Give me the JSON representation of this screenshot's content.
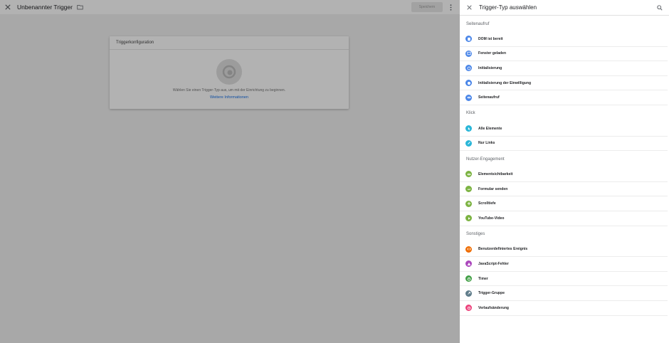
{
  "background": {
    "trigger_title": "Unbenannter Trigger",
    "save_label": "Speichern",
    "card_title": "Triggerkonfiguration",
    "hint": "Wählen Sie einen Trigger-Typ aus, um mit der Einrichtung zu beginnen.",
    "more_info": "Weitere Informationen"
  },
  "panel": {
    "title": "Trigger-Typ auswählen",
    "sections": [
      {
        "title": "Seitenaufruf",
        "items": [
          {
            "label": "DOM ist bereit",
            "icon": "document-icon",
            "color": "#4a86e8"
          },
          {
            "label": "Fenster geladen",
            "icon": "window-icon",
            "color": "#4a86e8"
          },
          {
            "label": "Initialisierung",
            "icon": "power-icon",
            "color": "#4a86e8"
          },
          {
            "label": "Initialisierung der Einwilligung",
            "icon": "consent-icon",
            "color": "#4a86e8"
          },
          {
            "label": "Seitenaufruf",
            "icon": "eye-icon",
            "color": "#4a86e8"
          }
        ]
      },
      {
        "title": "Klick",
        "items": [
          {
            "label": "Alle Elemente",
            "icon": "cursor-icon",
            "color": "#29b6d8"
          },
          {
            "label": "Nur Links",
            "icon": "link-icon",
            "color": "#29b6d8"
          }
        ]
      },
      {
        "title": "Nutzer-Engagement",
        "items": [
          {
            "label": "Elementsichtbarkeit",
            "icon": "visibility-icon",
            "color": "#7cb342"
          },
          {
            "label": "Formular senden",
            "icon": "form-icon",
            "color": "#7cb342"
          },
          {
            "label": "Scrolltiefe",
            "icon": "scroll-icon",
            "color": "#7cb342"
          },
          {
            "label": "YouTube-Video",
            "icon": "play-icon",
            "color": "#7cb342"
          }
        ]
      },
      {
        "title": "Sonstiges",
        "items": [
          {
            "label": "Benutzerdefiniertes Ereignis",
            "icon": "code-icon",
            "color": "#ef6c00"
          },
          {
            "label": "JavaScript-Fehler",
            "icon": "warning-icon",
            "color": "#ab47bc"
          },
          {
            "label": "Timer",
            "icon": "timer-icon",
            "color": "#43a047"
          },
          {
            "label": "Trigger-Gruppe",
            "icon": "group-icon",
            "color": "#607d8b"
          },
          {
            "label": "Verlaufsänderung",
            "icon": "history-icon",
            "color": "#ec407a"
          }
        ]
      }
    ]
  }
}
